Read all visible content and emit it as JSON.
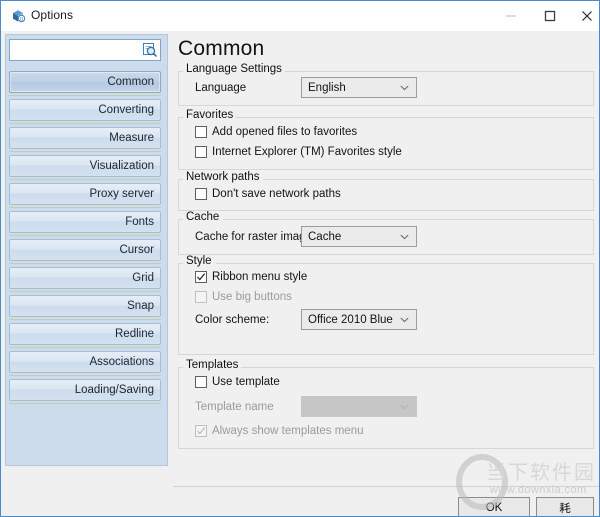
{
  "window": {
    "title": "Options",
    "icon": "app-cube-icon",
    "controls": {
      "minimize": "minimize-icon",
      "maximize": "maximize-icon",
      "close": "close-icon"
    }
  },
  "sidebar": {
    "search": {
      "value": "",
      "placeholder": "",
      "icon": "search-icon"
    },
    "items": [
      {
        "label": "Common",
        "selected": true
      },
      {
        "label": "Converting",
        "selected": false
      },
      {
        "label": "Measure",
        "selected": false
      },
      {
        "label": "Visualization",
        "selected": false
      },
      {
        "label": "Proxy server",
        "selected": false
      },
      {
        "label": "Fonts",
        "selected": false
      },
      {
        "label": "Cursor",
        "selected": false
      },
      {
        "label": "Grid",
        "selected": false
      },
      {
        "label": "Snap",
        "selected": false
      },
      {
        "label": "Redline",
        "selected": false
      },
      {
        "label": "Associations",
        "selected": false
      },
      {
        "label": "Loading/Saving",
        "selected": false
      }
    ]
  },
  "main": {
    "title": "Common",
    "groups": {
      "language_settings": {
        "label": "Language Settings",
        "language_label": "Language",
        "language_value": "English"
      },
      "favorites": {
        "label": "Favorites",
        "add_opened_files": {
          "label": "Add opened files to favorites",
          "checked": false,
          "disabled": false
        },
        "ie_style": {
          "label": "Internet Explorer (TM) Favorites style",
          "checked": false,
          "disabled": false
        }
      },
      "network_paths": {
        "label": "Network paths",
        "dont_save": {
          "label": "Don't save network paths",
          "checked": false,
          "disabled": false
        }
      },
      "cache": {
        "label": "Cache",
        "raster_label": "Cache for raster images:",
        "raster_value": "Cache"
      },
      "style": {
        "label": "Style",
        "ribbon_menu": {
          "label": "Ribbon menu style",
          "checked": true,
          "disabled": false
        },
        "big_buttons": {
          "label": "Use big buttons",
          "checked": false,
          "disabled": true
        },
        "color_scheme_label": "Color scheme:",
        "color_scheme_value": "Office 2010 Blue"
      },
      "templates": {
        "label": "Templates",
        "use_template": {
          "label": "Use template",
          "checked": false,
          "disabled": false
        },
        "template_name_label": "Template name",
        "template_name_value": "",
        "always_show": {
          "label": "Always show templates menu",
          "checked": true,
          "disabled": true
        }
      }
    }
  },
  "footer": {
    "ok_label": "OK",
    "cancel_label": "耗"
  },
  "watermark": {
    "brand": "当下软件园",
    "url": "www.downxia.com"
  },
  "colors": {
    "accent": "#4a8bc9",
    "sidebar_bg": "#cddcec",
    "panel_bg": "#f0f0f0"
  }
}
